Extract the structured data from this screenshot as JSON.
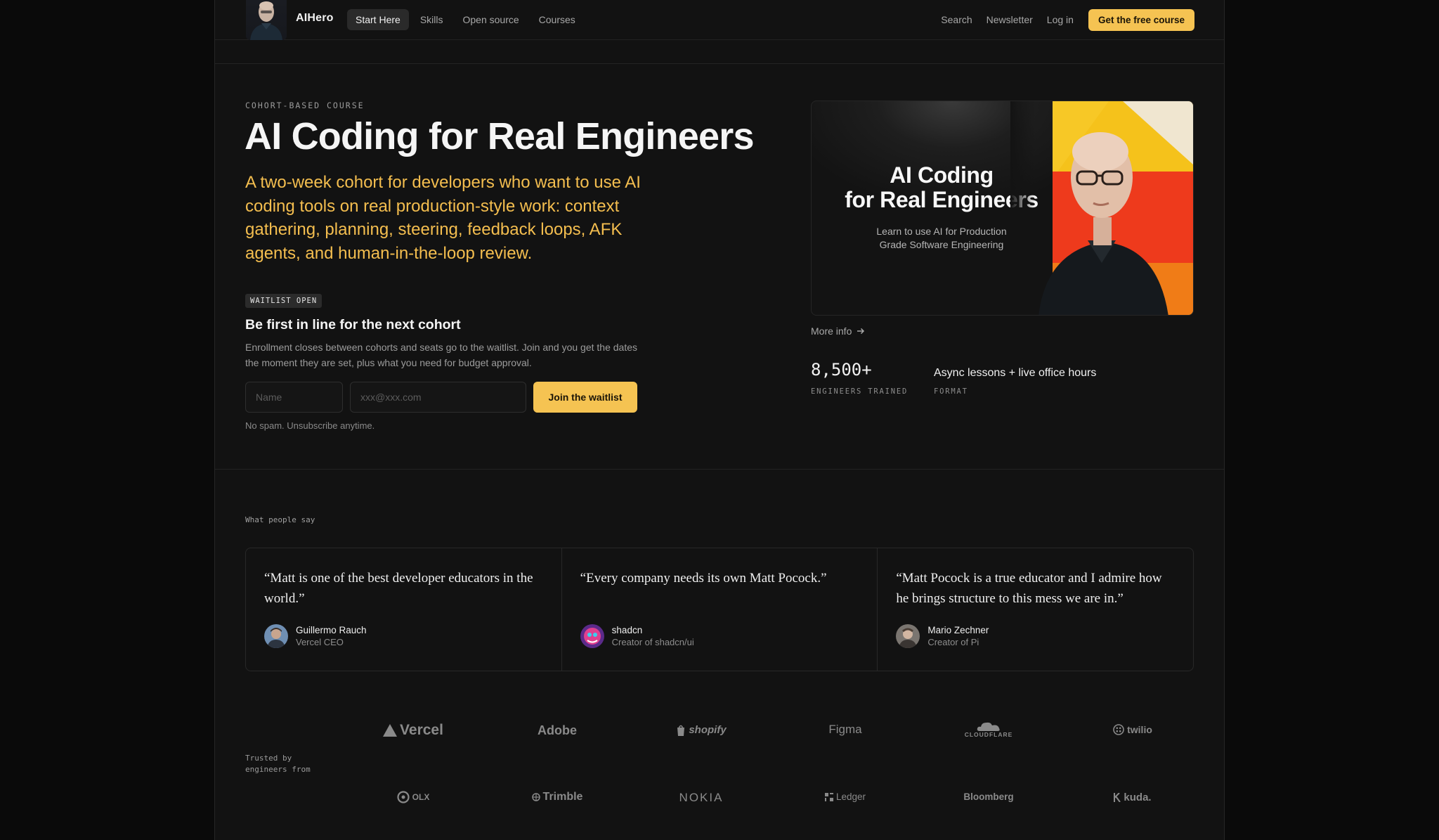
{
  "nav": {
    "brand": "AIHero",
    "links": [
      "Start Here",
      "Skills",
      "Open source",
      "Courses"
    ],
    "right_links": [
      "Search",
      "Newsletter",
      "Log in"
    ],
    "cta": "Get the free course"
  },
  "hero": {
    "eyebrow": "COHORT-BASED COURSE",
    "title": "AI Coding for Real Engineers",
    "subtitle": "A two-week cohort for developers who want to use AI coding tools on real production-style work: context gathering, planning, steering, feedback loops, AFK agents, and human-in-the-loop review.",
    "badge": "WAITLIST OPEN",
    "cohort_heading": "Be first in line for the next cohort",
    "cohort_text": "Enrollment closes between cohorts and seats go to the waitlist. Join and you get the dates the moment they are set, plus what you need for budget approval.",
    "form": {
      "name_placeholder": "Name",
      "email_placeholder": "xxx@xxx.com",
      "submit": "Join the waitlist",
      "note": "No spam. Unsubscribe anytime."
    }
  },
  "course_card": {
    "title_line1": "AI Coding",
    "title_line2": "for Real Engineers",
    "sub_line1": "Learn to use AI for Production",
    "sub_line2": "Grade Software Engineering"
  },
  "more_info": "More info",
  "stats": [
    {
      "value": "8,500+",
      "label": "ENGINEERS TRAINED"
    },
    {
      "value": "Async lessons + live office hours",
      "label": "FORMAT"
    }
  ],
  "testimonials_heading": "What people say",
  "testimonials": [
    {
      "quote": "“Matt is one of the best developer educators in the world.”",
      "name": "Guillermo Rauch",
      "role": "Vercel CEO"
    },
    {
      "quote": "“Every company needs its own Matt Pocock.”",
      "name": "shadcn",
      "role": "Creator of shadcn/ui"
    },
    {
      "quote": "“Matt Pocock is a true educator and I admire how he brings structure to this mess we are in.”",
      "name": "Mario Zechner",
      "role": "Creator of Pi"
    }
  ],
  "trusted_label": "Trusted by\nengineers from",
  "logos": [
    "Vercel",
    "Adobe",
    "shopify",
    "Figma",
    "CLOUDFLARE",
    "twilio",
    "OLX",
    "Trimble",
    "NOKIA",
    "Ledger",
    "Bloomberg",
    "kuda."
  ],
  "colors": {
    "accent": "#f5c352",
    "subtitle": "#f4be4f",
    "background": "#121212"
  }
}
